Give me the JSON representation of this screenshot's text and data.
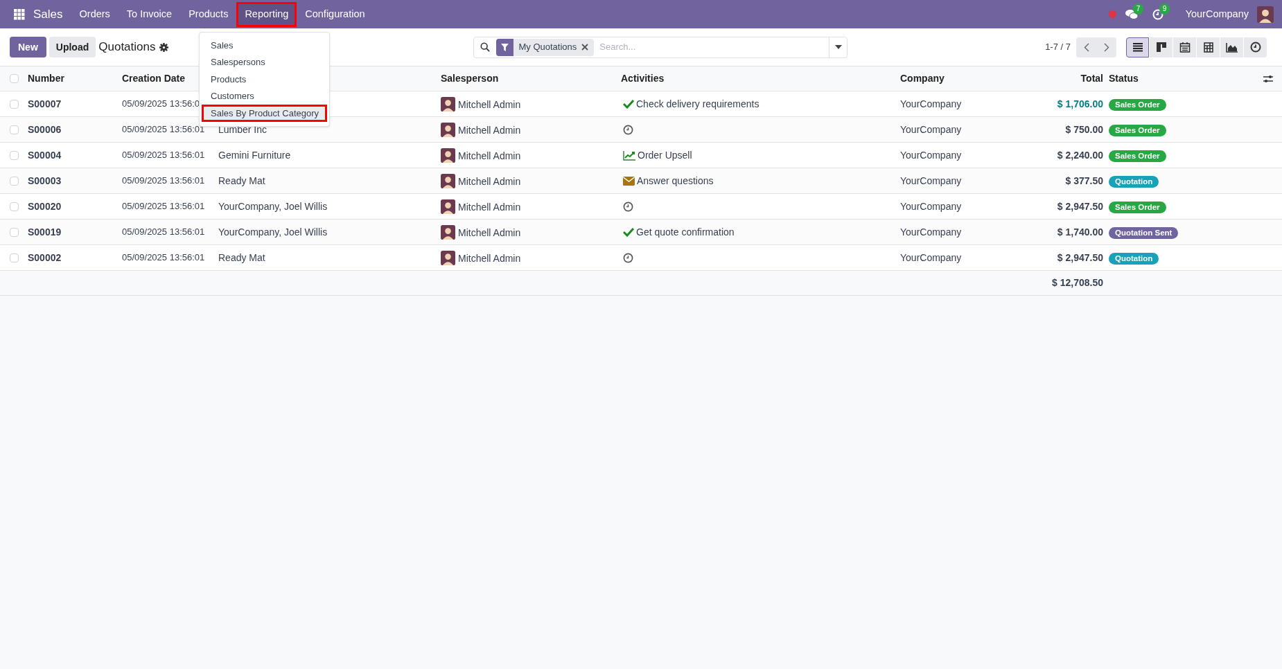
{
  "navbar": {
    "app_name": "Sales",
    "menu": [
      {
        "label": "Orders",
        "open": false,
        "highlighted": false
      },
      {
        "label": "To Invoice",
        "open": false,
        "highlighted": false
      },
      {
        "label": "Products",
        "open": false,
        "highlighted": false
      },
      {
        "label": "Reporting",
        "open": true,
        "highlighted": true
      },
      {
        "label": "Configuration",
        "open": false,
        "highlighted": false
      }
    ],
    "messages_count": "7",
    "activities_count": "9",
    "company": "YourCompany"
  },
  "dropdown": {
    "items": [
      {
        "label": "Sales",
        "highlighted": false
      },
      {
        "label": "Salespersons",
        "highlighted": false
      },
      {
        "label": "Products",
        "highlighted": false
      },
      {
        "label": "Customers",
        "highlighted": false
      },
      {
        "label": "Sales By Product Category",
        "highlighted": true
      }
    ]
  },
  "control_panel": {
    "new_button": "New",
    "upload_button": "Upload",
    "title": "Quotations",
    "search": {
      "facet": "My Quotations",
      "placeholder": "Search..."
    },
    "pager": "1-7 / 7",
    "views": [
      {
        "kind": "list",
        "selected": true
      },
      {
        "kind": "kanban",
        "selected": false
      },
      {
        "kind": "calendar",
        "selected": false
      },
      {
        "kind": "pivot",
        "selected": false
      },
      {
        "kind": "graph",
        "selected": false
      },
      {
        "kind": "activity",
        "selected": false
      }
    ]
  },
  "table": {
    "select_all_checked": false,
    "columns": [
      "Number",
      "Creation Date",
      "",
      "Salesperson",
      "Activities",
      "Company",
      "Total",
      "Status"
    ],
    "rows": [
      {
        "checked": false,
        "number": "S00007",
        "date": "05/09/2025 13:56:0",
        "customer": "",
        "salesperson": "Mitchell Admin",
        "activity": {
          "kind": "check",
          "label": "Check delivery requirements"
        },
        "company": "YourCompany",
        "total": "$ 1,706.00",
        "total_highlighted": true,
        "status": {
          "label": "Sales Order",
          "color": "#28a745"
        }
      },
      {
        "checked": false,
        "number": "S00006",
        "date": "05/09/2025 13:56:01",
        "customer": "Lumber Inc",
        "salesperson": "Mitchell Admin",
        "activity": {
          "kind": "clock"
        },
        "company": "YourCompany",
        "total": "$ 750.00",
        "total_highlighted": false,
        "status": {
          "label": "Sales Order",
          "color": "#28a745"
        }
      },
      {
        "checked": false,
        "number": "S00004",
        "date": "05/09/2025 13:56:01",
        "customer": "Gemini Furniture",
        "salesperson": "Mitchell Admin",
        "activity": {
          "kind": "chart",
          "label": "Order Upsell"
        },
        "company": "YourCompany",
        "total": "$ 2,240.00",
        "total_highlighted": false,
        "status": {
          "label": "Sales Order",
          "color": "#28a745"
        }
      },
      {
        "checked": false,
        "number": "S00003",
        "date": "05/09/2025 13:56:01",
        "customer": "Ready Mat",
        "salesperson": "Mitchell Admin",
        "activity": {
          "kind": "mail",
          "label": "Answer questions"
        },
        "company": "YourCompany",
        "total": "$ 377.50",
        "total_highlighted": false,
        "status": {
          "label": "Quotation",
          "color": "#17a2b8"
        }
      },
      {
        "checked": false,
        "number": "S00020",
        "date": "05/09/2025 13:56:01",
        "customer": "YourCompany, Joel Willis",
        "salesperson": "Mitchell Admin",
        "activity": {
          "kind": "clock"
        },
        "company": "YourCompany",
        "total": "$ 2,947.50",
        "total_highlighted": false,
        "status": {
          "label": "Sales Order",
          "color": "#28a745"
        }
      },
      {
        "checked": false,
        "number": "S00019",
        "date": "05/09/2025 13:56:01",
        "customer": "YourCompany, Joel Willis",
        "salesperson": "Mitchell Admin",
        "activity": {
          "kind": "check",
          "label": "Get quote confirmation"
        },
        "company": "YourCompany",
        "total": "$ 1,740.00",
        "total_highlighted": false,
        "status": {
          "label": "Quotation Sent",
          "color": "#71639e"
        }
      },
      {
        "checked": false,
        "number": "S00002",
        "date": "05/09/2025 13:56:01",
        "customer": "Ready Mat",
        "salesperson": "Mitchell Admin",
        "activity": {
          "kind": "clock"
        },
        "company": "YourCompany",
        "total": "$ 2,947.50",
        "total_highlighted": false,
        "status": {
          "label": "Quotation",
          "color": "#17a2b8"
        }
      }
    ],
    "grand_total": "$ 12,708.50"
  }
}
